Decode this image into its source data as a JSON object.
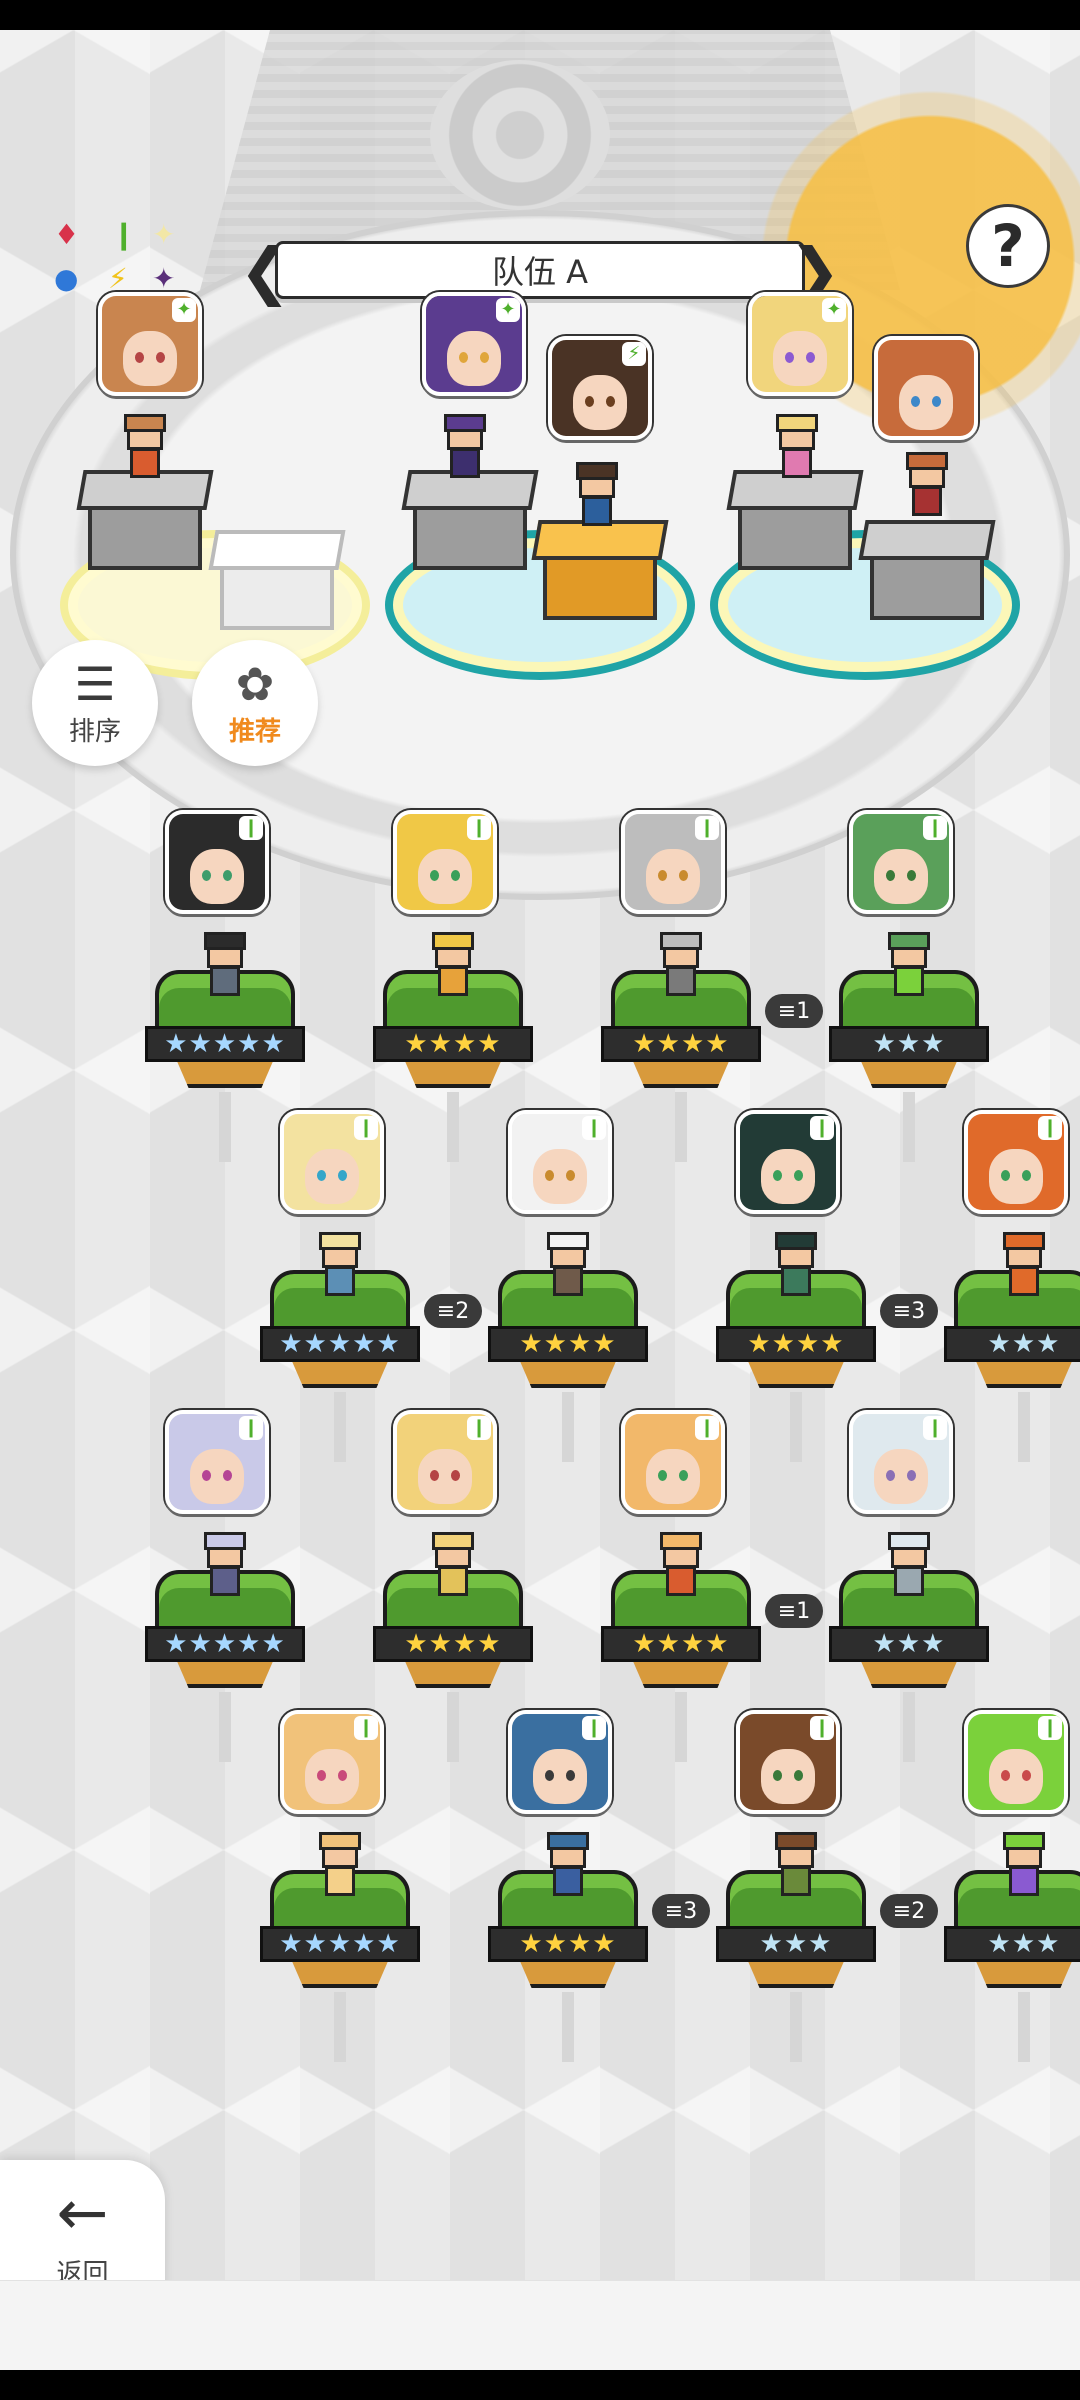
{
  "team": {
    "name": "队伍 A",
    "prev_arrow": "❮",
    "next_arrow": "❯"
  },
  "help_glyph": "?",
  "element_cycle": [
    "♦",
    "❙",
    "✦",
    "●",
    "⚡",
    "✦"
  ],
  "buttons": {
    "sort": {
      "icon": "sort-icon",
      "label": "排序"
    },
    "recommend": {
      "icon": "flower-icon",
      "label": "推荐"
    },
    "back": {
      "icon": "back-arrow-icon",
      "label": "返回"
    }
  },
  "colors": {
    "accent": "#f08a1d",
    "highlight": "#f6bf46",
    "grass": "#4f9a2e"
  },
  "team_slots": [
    {
      "hair": "#c9854f",
      "eye": "#b54545",
      "outfit": "#d95c2f",
      "badge": "✦"
    },
    {
      "hair": "#5b3c8f",
      "eye": "#e0a63b",
      "outfit": "#3d2f6e",
      "badge": "✦"
    },
    {
      "hair": "#4a3325",
      "eye": "#6b3f1f",
      "outfit": "#2c5f9c",
      "badge": "⚡"
    },
    {
      "hair": "#f1d57c",
      "eye": "#8c5ad1",
      "outfit": "#e07ab0",
      "badge": "✦"
    },
    {
      "hair": "#c76b3b",
      "eye": "#3d88c9",
      "outfit": "#a63232",
      "badge": ""
    }
  ],
  "roster": [
    {
      "hair": "#2b2b2b",
      "eye": "#3e9c6b",
      "outfit": "#5f6c7c",
      "stars": "★★★★★",
      "tier": "rainbow",
      "dup": ""
    },
    {
      "hair": "#f0c846",
      "eye": "#3aa05a",
      "outfit": "#e7a23a",
      "stars": "★★★★",
      "tier": "gold",
      "dup": ""
    },
    {
      "hair": "#bdbdbd",
      "eye": "#c98b2e",
      "outfit": "#7a7a7a",
      "stars": "★★★★",
      "tier": "gold",
      "dup": ""
    },
    {
      "hair": "#5aa05a",
      "eye": "#3a7a3a",
      "outfit": "#7bd13b",
      "stars": "★★★",
      "tier": "blue",
      "dup": "1"
    },
    {
      "hair": "#f3e2a0",
      "eye": "#35a6c9",
      "outfit": "#5c8fb5",
      "stars": "★★★★★",
      "tier": "rainbow",
      "dup": ""
    },
    {
      "hair": "#f2f2f2",
      "eye": "#c98b2e",
      "outfit": "#6f5a4a",
      "stars": "★★★★",
      "tier": "gold",
      "dup": "2"
    },
    {
      "hair": "#223b36",
      "eye": "#3aa05a",
      "outfit": "#3c7a5c",
      "stars": "★★★★",
      "tier": "gold",
      "dup": ""
    },
    {
      "hair": "#e06a2a",
      "eye": "#3aa05a",
      "outfit": "#e06a2a",
      "stars": "★★★",
      "tier": "blue",
      "dup": "3"
    },
    {
      "hair": "#c9c9e8",
      "eye": "#b54595",
      "outfit": "#5d5f8a",
      "stars": "★★★★★",
      "tier": "rainbow",
      "dup": ""
    },
    {
      "hair": "#f2d27a",
      "eye": "#b54545",
      "outfit": "#e3c25a",
      "stars": "★★★★",
      "tier": "gold",
      "dup": ""
    },
    {
      "hair": "#f2b86a",
      "eye": "#3aa05a",
      "outfit": "#d95c2f",
      "stars": "★★★★",
      "tier": "gold",
      "dup": ""
    },
    {
      "hair": "#dfe9ee",
      "eye": "#8a6fb5",
      "outfit": "#9aa8b0",
      "stars": "★★★",
      "tier": "blue",
      "dup": "1"
    },
    {
      "hair": "#f1c27a",
      "eye": "#c94a7a",
      "outfit": "#f4d08a",
      "stars": "★★★★★",
      "tier": "rainbow",
      "dup": ""
    },
    {
      "hair": "#3a6fa0",
      "eye": "#3a3a3a",
      "outfit": "#3a5fa0",
      "stars": "★★★★",
      "tier": "gold",
      "dup": ""
    },
    {
      "hair": "#7a4a2a",
      "eye": "#3a7a3a",
      "outfit": "#6a8a3a",
      "stars": "★★★",
      "tier": "blue",
      "dup": "3"
    },
    {
      "hair": "#7bd13b",
      "eye": "#c94a4a",
      "outfit": "#8a5ad1",
      "stars": "★★★",
      "tier": "blue",
      "dup": "2"
    }
  ]
}
